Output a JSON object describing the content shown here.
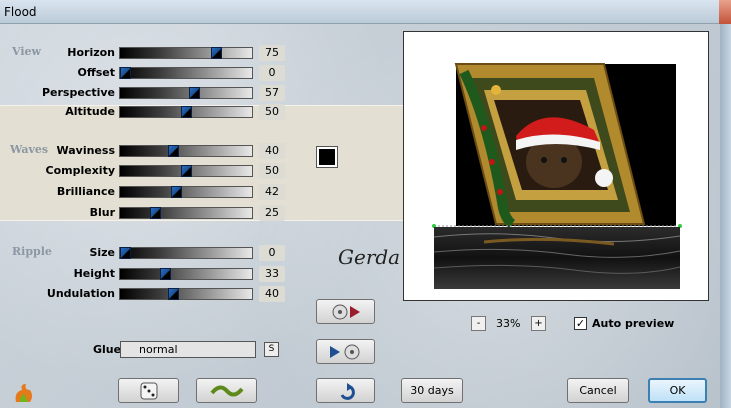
{
  "window": {
    "title": "Flood"
  },
  "groups": {
    "view": "View",
    "waves": "Waves",
    "ripple": "Ripple"
  },
  "params": [
    {
      "label": "Horizon",
      "value": "75",
      "level": 0.75
    },
    {
      "label": "Offset",
      "value": "0",
      "level": 0.0
    },
    {
      "label": "Perspective",
      "value": "57",
      "level": 0.57
    },
    {
      "label": "Altitude",
      "value": "50",
      "level": 0.5
    },
    {
      "label": "Waviness",
      "value": "40",
      "level": 0.4
    },
    {
      "label": "Complexity",
      "value": "50",
      "level": 0.5
    },
    {
      "label": "Brilliance",
      "value": "42",
      "level": 0.42
    },
    {
      "label": "Blur",
      "value": "25",
      "level": 0.25
    },
    {
      "label": "Size",
      "value": "0",
      "level": 0.0
    },
    {
      "label": "Height",
      "value": "33",
      "level": 0.33
    },
    {
      "label": "Undulation",
      "value": "40",
      "level": 0.4
    }
  ],
  "colors": {
    "waves_color": "#000000",
    "accent": "#1d4f91"
  },
  "signature": "Gerda",
  "glue": {
    "label": "Glue",
    "value": "normal",
    "button": "S"
  },
  "zoom": {
    "minus": "-",
    "value": "33%",
    "plus": "+"
  },
  "auto_preview": {
    "label": "Auto preview",
    "checked": true
  },
  "buttons": {
    "trial": "30 days left",
    "cancel": "Cancel",
    "ok": "OK"
  },
  "icons": {
    "logo": "flame-logo-icon",
    "random": "dice-icon",
    "reset": "wave-icon",
    "load": "disc-arrow-icon",
    "save": "arrow-disc-icon",
    "undo": "undo-arrow-icon"
  }
}
